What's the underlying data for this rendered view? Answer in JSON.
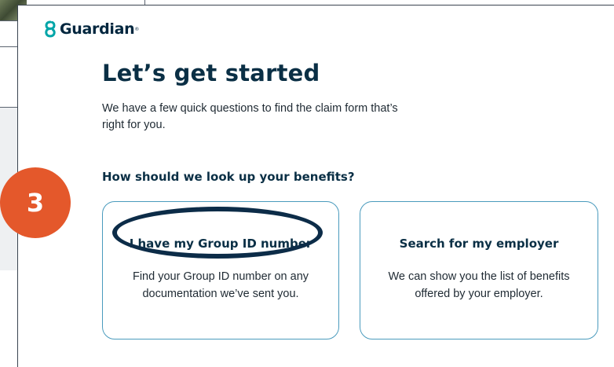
{
  "brand": {
    "name": "Guardian",
    "trademark": "®",
    "color": "#00263e",
    "accent": "#00a5a8"
  },
  "page": {
    "title": "Let’s get started",
    "intro": "We have a few quick questions to find the claim form that’s right for you.",
    "question": "How should we look up your benefits?"
  },
  "options": [
    {
      "title": "I have my Group ID number",
      "description": "Find your Group ID number on any documentation we’ve sent you."
    },
    {
      "title": "Search for my employer",
      "description": "We can show you the list of benefits offered by your employer."
    }
  ],
  "annotation": {
    "step_number": "3",
    "badge_color": "#e4582b",
    "highlight_color": "#0c2c48"
  },
  "colors": {
    "heading": "#0a2f45",
    "card_border": "#4a9bbd"
  }
}
